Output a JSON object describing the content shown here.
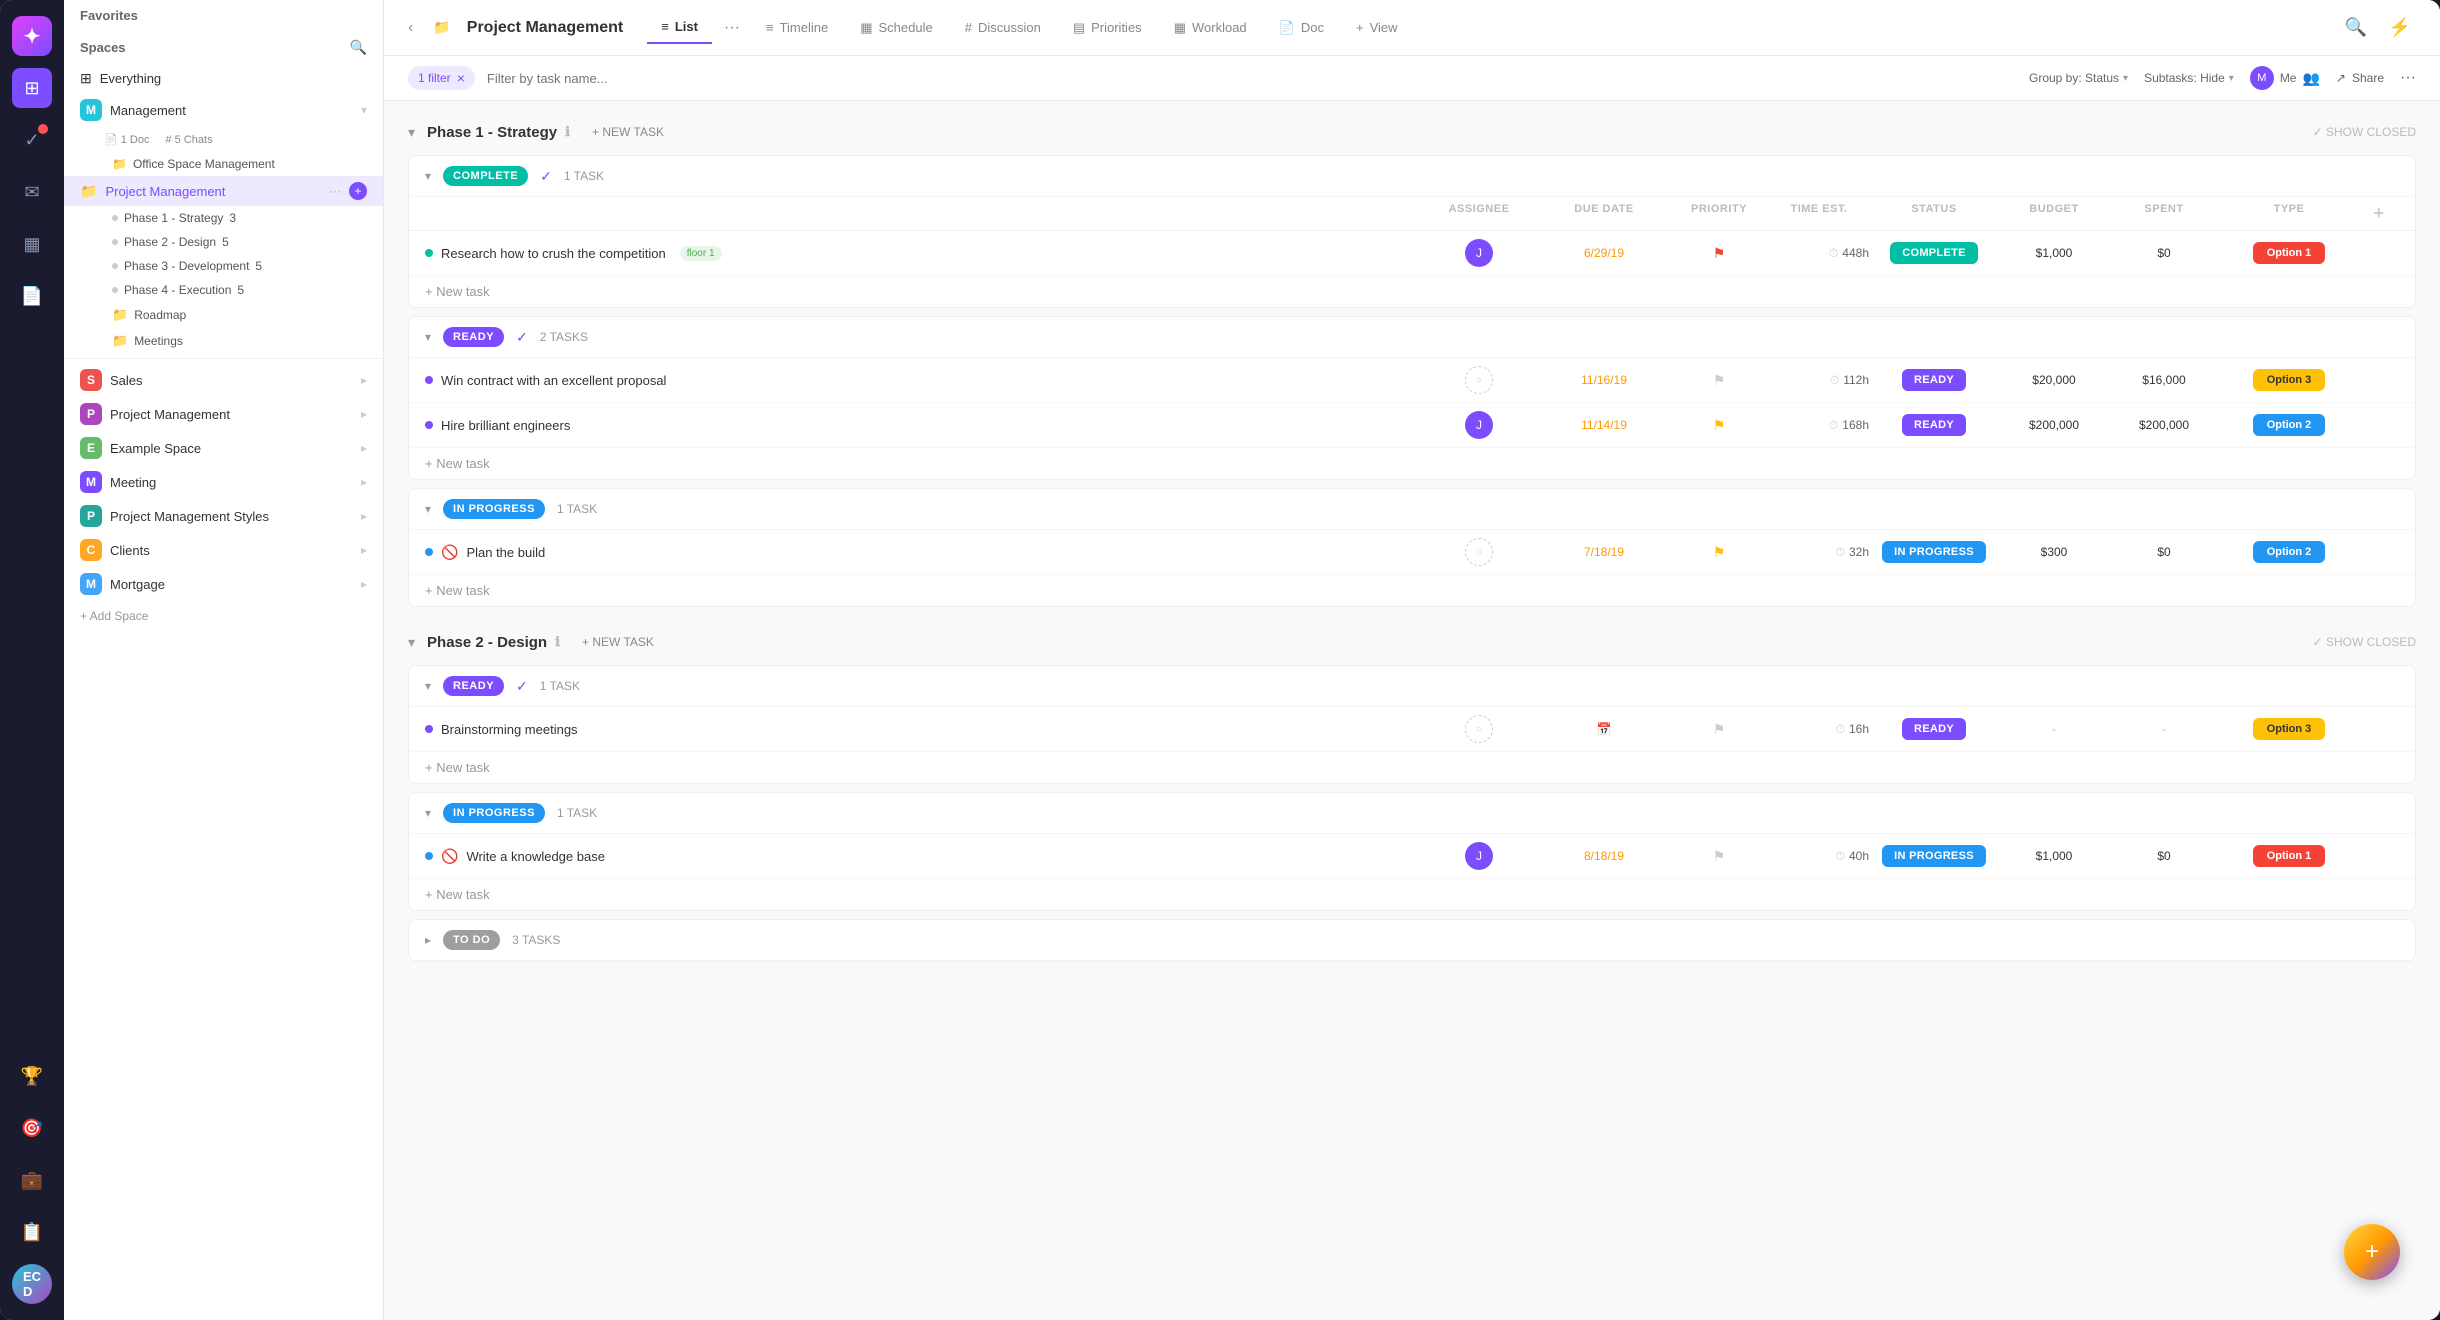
{
  "app": {
    "logo": "✦",
    "collapse_icon": "‹"
  },
  "iconbar": {
    "items": [
      {
        "name": "home-icon",
        "icon": "⊞",
        "active": false
      },
      {
        "name": "check-icon",
        "icon": "✓",
        "active": true
      },
      {
        "name": "bell-icon",
        "icon": "🔔",
        "active": false,
        "badge": true
      },
      {
        "name": "inbox-icon",
        "icon": "✉",
        "active": false
      },
      {
        "name": "dashboard-icon",
        "icon": "▦",
        "active": false
      },
      {
        "name": "doc-icon",
        "icon": "📄",
        "active": false
      }
    ],
    "bottom": [
      {
        "name": "trophy-icon",
        "icon": "🏆"
      },
      {
        "name": "briefcase-icon",
        "icon": "💼"
      },
      {
        "name": "doc2-icon",
        "icon": "📋"
      }
    ],
    "avatar": {
      "initials": "EC\nD"
    }
  },
  "sidebar": {
    "favorites_label": "Favorites",
    "spaces_label": "Spaces",
    "everything_label": "Everything",
    "spaces": [
      {
        "name": "Management",
        "icon": "M",
        "color": "#26c6da",
        "expanded": true,
        "children": [
          {
            "label": "1 Doc",
            "icon": "📄"
          },
          {
            "label": "5 Chats",
            "icon": "#"
          }
        ],
        "sub_items": [
          {
            "label": "Office Space Management",
            "icon": "📁"
          },
          {
            "label": "Project Management",
            "icon": "📁",
            "active": true,
            "actions": [
              "···",
              "+"
            ],
            "children": [
              {
                "label": "Phase 1 - Strategy",
                "count": "3"
              },
              {
                "label": "Phase 2 - Design",
                "count": "5"
              },
              {
                "label": "Phase 3 - Development",
                "count": "5"
              },
              {
                "label": "Phase 4 - Execution",
                "count": "5"
              }
            ]
          },
          {
            "label": "Roadmap",
            "icon": "📁"
          },
          {
            "label": "Meetings",
            "icon": "📁"
          }
        ]
      },
      {
        "name": "Sales",
        "icon": "S",
        "color": "#ef5350"
      },
      {
        "name": "Project Management",
        "icon": "P",
        "color": "#ab47bc"
      },
      {
        "name": "Example Space",
        "icon": "E",
        "color": "#66bb6a"
      },
      {
        "name": "Meeting",
        "icon": "M",
        "color": "#7c4dff"
      },
      {
        "name": "Project Management Styles",
        "icon": "P",
        "color": "#26a69a"
      },
      {
        "name": "Clients",
        "icon": "C",
        "color": "#ffa726"
      },
      {
        "name": "Mortgage",
        "icon": "M",
        "color": "#42a5f5"
      }
    ],
    "add_space": "+ Add Space"
  },
  "topbar": {
    "page_icon": "📁",
    "title": "Project Management",
    "tabs": [
      {
        "label": "List",
        "icon": "≡",
        "active": true
      },
      {
        "label": "Timeline",
        "icon": "≡"
      },
      {
        "label": "Schedule",
        "icon": "▦"
      },
      {
        "label": "Discussion",
        "icon": "#"
      },
      {
        "label": "Priorities",
        "icon": "▤"
      },
      {
        "label": "Workload",
        "icon": "▦"
      },
      {
        "label": "Doc",
        "icon": "📄"
      }
    ],
    "more_tabs": "···",
    "plus_view": "+ View",
    "search_icon": "🔍",
    "lightning_icon": "⚡",
    "group_by": "Group by: Status",
    "subtasks": "Subtasks: Hide",
    "me_label": "Me",
    "share_label": "Share",
    "dots": "···"
  },
  "filter_bar": {
    "filter_count": "1 filter",
    "filter_placeholder": "Filter by task name...",
    "group_by_label": "Group by: Status",
    "subtasks_label": "Subtasks: Hide",
    "me_label": "Me",
    "share_label": "Share",
    "dots": "···"
  },
  "phases": [
    {
      "title": "Phase 1 - Strategy",
      "groups": [
        {
          "status": "COMPLETE",
          "status_class": "badge-complete",
          "status_pill_class": "s-complete",
          "task_count": "1 TASK",
          "tasks": [
            {
              "name": "Research how to crush the competition",
              "tag": "floor 1",
              "assignee": "J",
              "assignee_color": "#7c4dff",
              "due_date": "6/29/19",
              "date_class": "date-orange",
              "priority": "red",
              "time_est": "448h",
              "status": "COMPLETE",
              "status_class": "s-complete",
              "budget": "$1,000",
              "spent": "$0",
              "type": "Option 1",
              "type_class": "type-red"
            }
          ]
        },
        {
          "status": "READY",
          "status_class": "badge-ready",
          "status_pill_class": "s-ready",
          "task_count": "2 TASKS",
          "tasks": [
            {
              "name": "Win contract with an excellent proposal",
              "assignee": null,
              "due_date": "11/16/19",
              "date_class": "date-orange",
              "priority": "gray",
              "time_est": "112h",
              "status": "READY",
              "status_class": "s-ready",
              "budget": "$20,000",
              "spent": "$16,000",
              "type": "Option 3",
              "type_class": "type-yellow"
            },
            {
              "name": "Hire brilliant engineers",
              "assignee": "J",
              "assignee_color": "#7c4dff",
              "due_date": "11/14/19",
              "date_class": "date-orange",
              "priority": "yellow",
              "time_est": "168h",
              "status": "READY",
              "status_class": "s-ready",
              "budget": "$200,000",
              "spent": "$200,000",
              "type": "Option 2",
              "type_class": "type-blue"
            }
          ]
        },
        {
          "status": "IN PROGRESS",
          "status_class": "badge-inprogress",
          "status_pill_class": "s-inprogress",
          "task_count": "1 TASK",
          "tasks": [
            {
              "name": "Plan the build",
              "blocker": true,
              "assignee": null,
              "due_date": "7/18/19",
              "date_class": "date-orange",
              "priority": "yellow",
              "time_est": "32h",
              "status": "IN PROGRESS",
              "status_class": "s-inprogress",
              "budget": "$300",
              "spent": "$0",
              "type": "Option 2",
              "type_class": "type-blue"
            }
          ]
        }
      ]
    },
    {
      "title": "Phase 2 - Design",
      "groups": [
        {
          "status": "READY",
          "status_class": "badge-ready",
          "status_pill_class": "s-ready",
          "task_count": "1 TASK",
          "tasks": [
            {
              "name": "Brainstorming meetings",
              "assignee": null,
              "due_date": null,
              "date_class": "",
              "priority": "gray",
              "time_est": "16h",
              "status": "READY",
              "status_class": "s-ready",
              "budget": "-",
              "spent": "-",
              "type": "Option 3",
              "type_class": "type-yellow"
            }
          ]
        },
        {
          "status": "IN PROGRESS",
          "status_class": "badge-inprogress",
          "status_pill_class": "s-inprogress",
          "task_count": "1 TASK",
          "tasks": [
            {
              "name": "Write a knowledge base",
              "blocker": true,
              "assignee": "J",
              "assignee_color": "#7c4dff",
              "due_date": "8/18/19",
              "date_class": "date-orange",
              "priority": "gray",
              "time_est": "40h",
              "status": "IN PROGRESS",
              "status_class": "s-inprogress",
              "budget": "$1,000",
              "spent": "$0",
              "type": "Option 1",
              "type_class": "type-red"
            }
          ]
        },
        {
          "status": "TO DO",
          "status_class": "badge-todo",
          "status_pill_class": "s-todo",
          "task_count": "3 TASKS",
          "tasks": []
        }
      ]
    }
  ],
  "columns": {
    "headers": [
      "ASSIGNEE",
      "DUE DATE",
      "PRIORITY",
      "TIME EST.",
      "STATUS",
      "BUDGET",
      "SPENT",
      "TYPE",
      ""
    ]
  },
  "new_task_label": "+ New task",
  "show_closed_label": "✓ SHOW CLOSED"
}
